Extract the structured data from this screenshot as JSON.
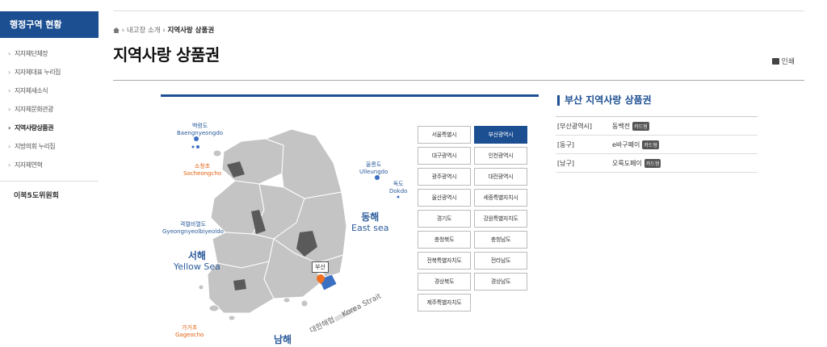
{
  "sidebar": {
    "title": "행정구역 현황",
    "items": [
      {
        "label": "지자체단체장",
        "active": false
      },
      {
        "label": "지자체대표 누리집",
        "active": false
      },
      {
        "label": "지자체새소식",
        "active": false
      },
      {
        "label": "지자체문화관광",
        "active": false
      },
      {
        "label": "지역사랑상품권",
        "active": true
      },
      {
        "label": "지방의회 누리집",
        "active": false
      },
      {
        "label": "지자체연혁",
        "active": false
      }
    ],
    "section2": "이북5도위원회"
  },
  "breadcrumb": {
    "parent": "내고장 소개",
    "current": "지역사랑 상품권"
  },
  "page_title": "지역사랑 상품권",
  "print_label": "인쇄",
  "map": {
    "labels": {
      "baengnyeongdo": {
        "ko": "백령도",
        "en": "Baengnyeongdo"
      },
      "socheongcho": {
        "ko": "소청초",
        "en": "Socheongcho"
      },
      "ulleungdo": {
        "ko": "울릉도",
        "en": "Ulleungdo"
      },
      "dokdo": {
        "ko": "독도",
        "en": "Dokdo"
      },
      "gyeongnyeolbiyeoldo": {
        "ko": "격렬비열도",
        "en": "Gyeongnyeolbiyeoldo"
      },
      "gageocho": {
        "ko": "가거초",
        "en": "Gageocho"
      },
      "east_sea": {
        "ko": "동해",
        "en": "East sea"
      },
      "yellow_sea": {
        "ko": "서해",
        "en": "Yellow Sea"
      },
      "south_sea": {
        "ko": "남해"
      },
      "korea_strait": {
        "ko": "대한해협",
        "en": "Korea Strait"
      }
    },
    "pin_label": "부산",
    "colors": {
      "land": "#c4c4c4",
      "highlight": "#3b6fc2",
      "dark": "#5a5a5a",
      "pin": "#f07020"
    }
  },
  "regions": [
    {
      "label": "서울특별시",
      "active": false
    },
    {
      "label": "부산광역시",
      "active": true
    },
    {
      "label": "대구광역시",
      "active": false
    },
    {
      "label": "인천광역시",
      "active": false
    },
    {
      "label": "광주광역시",
      "active": false
    },
    {
      "label": "대전광역시",
      "active": false
    },
    {
      "label": "울산광역시",
      "active": false
    },
    {
      "label": "세종특별자치시",
      "active": false
    },
    {
      "label": "경기도",
      "active": false
    },
    {
      "label": "강원특별자치도",
      "active": false
    },
    {
      "label": "충청북도",
      "active": false
    },
    {
      "label": "충청남도",
      "active": false
    },
    {
      "label": "전북특별자치도",
      "active": false
    },
    {
      "label": "전라남도",
      "active": false
    },
    {
      "label": "경상북도",
      "active": false
    },
    {
      "label": "경상남도",
      "active": false
    },
    {
      "label": "제주특별자치도",
      "active": false
    }
  ],
  "info": {
    "title": "부산 지역사랑 상품권",
    "rows": [
      {
        "region": "[부산광역시]",
        "name": "동백전",
        "type": "카드형"
      },
      {
        "region": "[동구]",
        "name": "e바구페이",
        "type": "카드형"
      },
      {
        "region": "[남구]",
        "name": "오륙도페이",
        "type": "카드형"
      }
    ]
  }
}
